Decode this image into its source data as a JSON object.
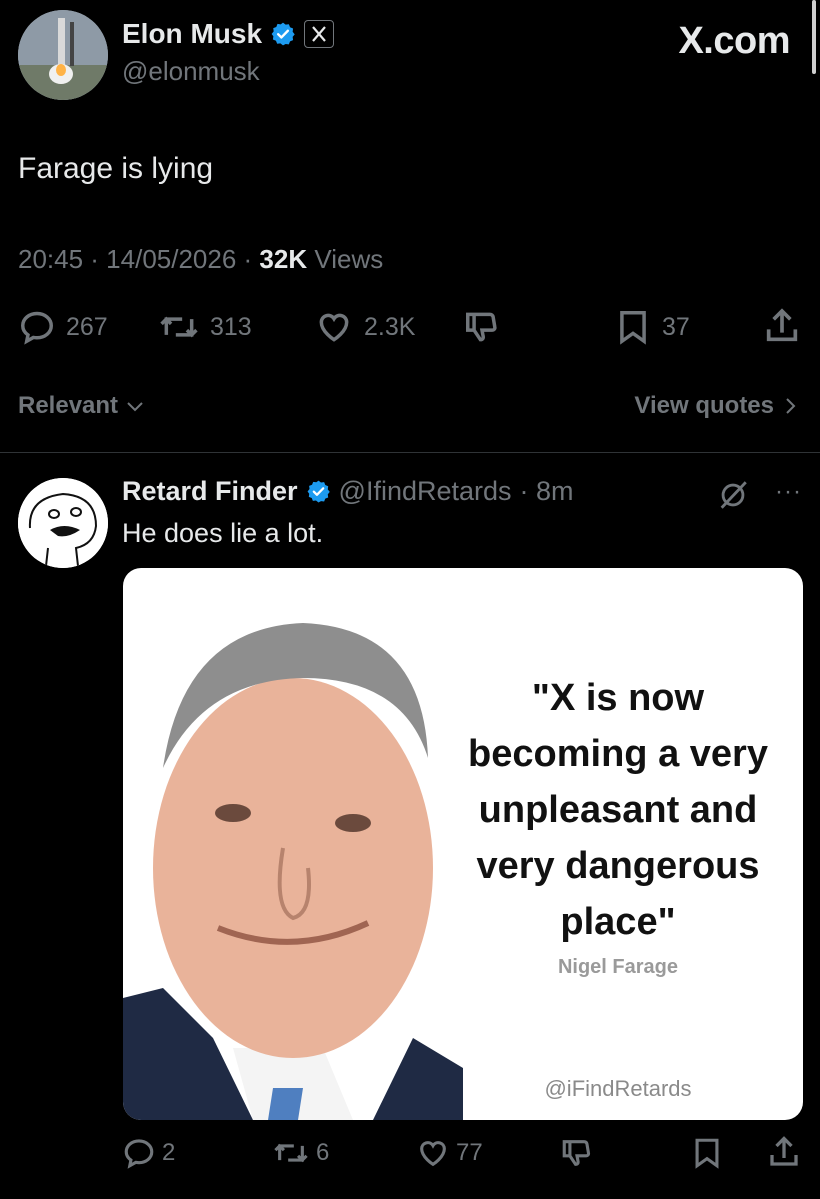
{
  "post": {
    "author": "Elon Musk",
    "handle": "@elonmusk",
    "site": "X.com",
    "text": "Farage is lying",
    "time": "20:45 · 14/05/2026 · ",
    "views_count": "32K",
    "views_label": " Views",
    "replies": "267",
    "reposts": "313",
    "likes": "2.3K",
    "bookmarks": "37"
  },
  "sort": {
    "relevant_label": "Relevant",
    "view_quotes_label": "View quotes"
  },
  "reply": {
    "author": "Retard Finder",
    "handle": "@IfindRetards",
    "age": "· 8m",
    "text": "He does lie a lot.",
    "more": "···",
    "image": {
      "quote_line1": "\"X is now",
      "quote_line2": "becoming a very",
      "quote_line3": "unpleasant and",
      "quote_line4": "very dangerous",
      "quote_line5": "place\"",
      "attribution": "Nigel Farage",
      "watermark": "@iFindRetards"
    },
    "replies": "2",
    "reposts": "6",
    "likes": "77"
  },
  "colors": {
    "background": "#000000",
    "text": "#e7e9ea",
    "muted": "#71767b",
    "verified": "#1d9bf0",
    "divider": "#2f3336"
  }
}
